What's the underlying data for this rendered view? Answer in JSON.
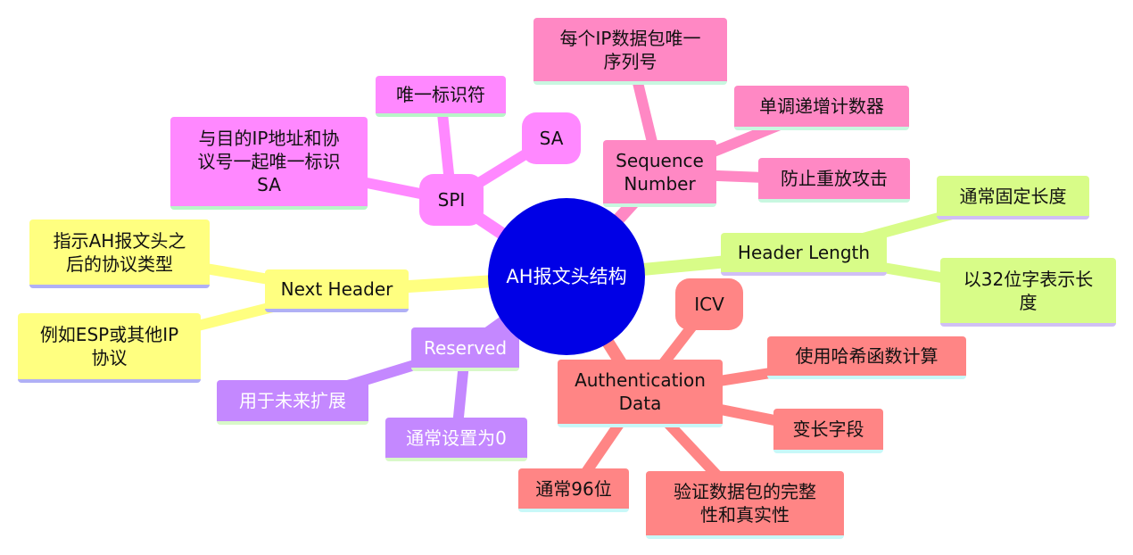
{
  "root": {
    "label": "AH报文头结构",
    "color": "#0000e6"
  },
  "branches": [
    {
      "id": "spi",
      "label": "SPI",
      "color": "#ff88ff",
      "underline": "#b8f5c8",
      "children": [
        {
          "label": "唯一标识符"
        },
        {
          "label": "SA"
        },
        {
          "label": "与目的IP地址和协\n议号一起唯一标识\nSA"
        }
      ]
    },
    {
      "id": "sequence-number",
      "label": "Sequence\nNumber",
      "color": "#ff88c4",
      "underline": "#c8f7e0",
      "children": [
        {
          "label": "每个IP数据包唯一\n序列号"
        },
        {
          "label": "单调递增计数器"
        },
        {
          "label": "防止重放攻击"
        }
      ]
    },
    {
      "id": "header-length",
      "label": "Header Length",
      "color": "#d8fc88",
      "underline": "#d0bff5",
      "children": [
        {
          "label": "通常固定长度"
        },
        {
          "label": "以32位字表示长\n度"
        }
      ]
    },
    {
      "id": "next-header",
      "label": "Next Header",
      "color": "#ffff80",
      "underline": "#b0b0f5",
      "children": [
        {
          "label": "指示AH报文头之\n后的协议类型"
        },
        {
          "label": "例如ESP或其他IP\n协议"
        }
      ]
    },
    {
      "id": "reserved",
      "label": "Reserved",
      "color": "#c488ff",
      "underline": "#d8f8c8",
      "children": [
        {
          "label": "用于未来扩展"
        },
        {
          "label": "通常设置为0"
        }
      ]
    },
    {
      "id": "authentication-data",
      "label": "Authentication\nData",
      "color": "#ff8585",
      "underline": "#c8f8f8",
      "children": [
        {
          "label": "ICV"
        },
        {
          "label": "使用哈希函数计算"
        },
        {
          "label": "变长字段"
        },
        {
          "label": "验证数据包的完整\n性和真实性"
        },
        {
          "label": "通常96位"
        }
      ]
    }
  ]
}
